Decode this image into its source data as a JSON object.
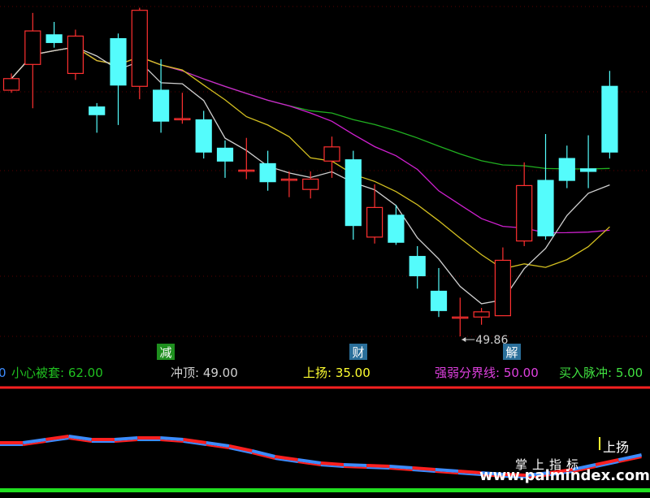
{
  "chart_data": {
    "type": "candlestick",
    "candles": [
      {
        "o": 105,
        "c": 114,
        "h": 118,
        "l": 103
      },
      {
        "o": 125,
        "c": 151,
        "h": 165,
        "l": 91
      },
      {
        "o": 148,
        "c": 142,
        "h": 158,
        "l": 138
      },
      {
        "o": 118,
        "c": 147,
        "h": 152,
        "l": 113
      },
      {
        "o": 92,
        "c": 86,
        "h": 95,
        "l": 72
      },
      {
        "o": 145,
        "c": 109,
        "h": 149,
        "l": 78
      },
      {
        "o": 108,
        "c": 167,
        "h": 169,
        "l": 98
      },
      {
        "o": 105,
        "c": 81,
        "h": 129,
        "l": 72
      },
      {
        "o": 83,
        "c": 83,
        "h": 103,
        "l": 79
      },
      {
        "o": 82,
        "c": 57,
        "h": 89,
        "l": 52
      },
      {
        "o": 60,
        "c": 50,
        "h": 66,
        "l": 37
      },
      {
        "o": 43,
        "c": 43,
        "h": 68,
        "l": 36
      },
      {
        "o": 48,
        "c": 34,
        "h": 58,
        "l": 27
      },
      {
        "o": 36,
        "c": 36,
        "h": 42,
        "l": 22
      },
      {
        "o": 28,
        "c": 36,
        "h": 42,
        "l": 21
      },
      {
        "o": 50,
        "c": 61,
        "h": 69,
        "l": 37
      },
      {
        "o": 51,
        "c": 0,
        "h": 58,
        "l": -11
      },
      {
        "o": -9,
        "c": 14,
        "h": 32,
        "l": -14
      },
      {
        "o": 8,
        "c": -13,
        "h": 16,
        "l": -15
      },
      {
        "o": -24,
        "c": -39,
        "h": -16,
        "l": -49
      },
      {
        "o": -51,
        "c": -66,
        "h": -33,
        "l": -71
      },
      {
        "o": -71,
        "c": -71,
        "h": -56,
        "l": -86
      },
      {
        "o": -71,
        "c": -67,
        "h": -64,
        "l": -77
      },
      {
        "o": -70,
        "c": -27,
        "h": -17,
        "l": -69
      },
      {
        "o": -12,
        "c": 31,
        "h": 49,
        "l": -16
      },
      {
        "o": 35,
        "c": -8,
        "h": 71,
        "l": -11
      },
      {
        "o": 52,
        "c": 35,
        "h": 62,
        "l": 29
      },
      {
        "o": 44,
        "c": 42,
        "h": 70,
        "l": 29
      },
      {
        "o": 108,
        "c": 57,
        "h": 120,
        "l": 52
      }
    ],
    "ylim": [
      -86,
      175
    ],
    "annotations": {
      "low_label": "49.86",
      "markers": [
        {
          "text": "减",
          "color": "#1e8f1e"
        },
        {
          "text": "财",
          "color": "#2a6f9a"
        },
        {
          "text": "解",
          "color": "#2a6f9a"
        }
      ]
    },
    "legend": [
      {
        "text": "0",
        "color": "#3d8cff"
      },
      {
        "text": "小心被套: 62.00",
        "color": "#20c020"
      },
      {
        "text": "冲顶: 49.00",
        "color": "#d0d0d0"
      },
      {
        "text": "上扬: 35.00",
        "color": "#ffff30"
      },
      {
        "text": "强弱分界线: 50.00",
        "color": "#e040e0"
      },
      {
        "text": "买入脉冲: 5.00",
        "color": "#40e040"
      }
    ],
    "indicator_label": "上扬"
  },
  "watermark": {
    "cn": "掌上指标",
    "url": "www.palmindex.com"
  },
  "colors": {
    "up": "#ff3030",
    "down": "#54fcfc",
    "ma_white": "#d0d0d0",
    "ma_yellow": "#d4c020",
    "ma_magenta": "#d020d0",
    "ma_green": "#20b020",
    "indicator_red": "#ff2020",
    "indicator_blue": "#3d8cff",
    "bottom_bar": "#20e020"
  }
}
